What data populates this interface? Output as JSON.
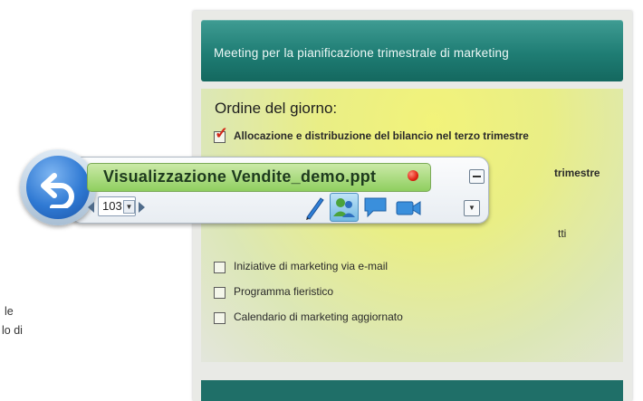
{
  "slide": {
    "title": "Meeting per la pianificazione trimestrale di marketing",
    "agenda_heading": "Ordine del giorno:",
    "items": [
      {
        "text": "Allocazione e distribuzione del bilancio nel terzo trimestre",
        "checked": true
      },
      {
        "text": "trimestre",
        "checked": true
      },
      {
        "text": "tti",
        "checked": false
      },
      {
        "text": "Iniziative di marketing via e-mail",
        "checked": false
      },
      {
        "text": "Programma fieristico",
        "checked": false
      },
      {
        "text": "Calendario di marketing aggiornato",
        "checked": false
      }
    ]
  },
  "side_caption": {
    "line1": "le",
    "line2": "lo di"
  },
  "toolbar": {
    "file_title": "Visualizzazione Vendite_demo.ppt",
    "page_number": "103",
    "tools": [
      "pen-icon",
      "participants-icon",
      "chat-icon",
      "camera-icon"
    ],
    "active_tool": "participants-icon"
  },
  "colors": {
    "header_teal": "#1f7d74",
    "title_green": "#8fcf5f",
    "back_blue": "#2f79d3",
    "check_red": "#d2281a"
  }
}
